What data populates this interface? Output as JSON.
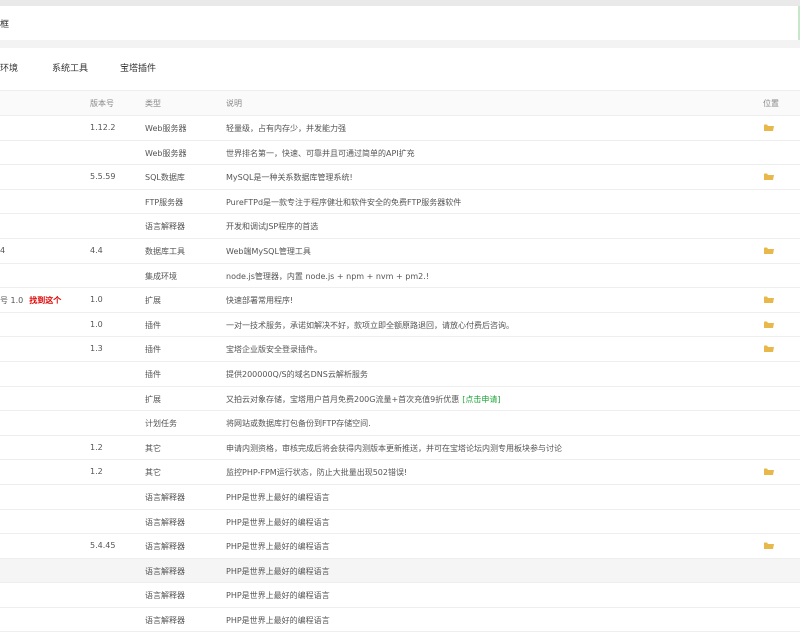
{
  "search": {
    "text": "框"
  },
  "tabs": [
    "环境",
    "系统工具",
    "宝塔插件"
  ],
  "table": {
    "headers": {
      "version": "版本号",
      "type": "类型",
      "desc": "说明",
      "location": "位置"
    },
    "rows": [
      {
        "name": "",
        "version": "1.12.2",
        "type": "Web服务器",
        "desc": "轻量级，占有内存少，并发能力强",
        "folder": true
      },
      {
        "name": "",
        "version": "",
        "type": "Web服务器",
        "desc": "世界排名第一，快速、可靠并且可通过简单的API扩充",
        "folder": false
      },
      {
        "name": "",
        "version": "5.5.59",
        "type": "SQL数据库",
        "desc": "MySQL是一种关系数据库管理系统!",
        "folder": true
      },
      {
        "name": "",
        "version": "",
        "type": "FTP服务器",
        "desc": "PureFTPd是一款专注于程序健壮和软件安全的免费FTP服务器软件",
        "folder": false
      },
      {
        "name": "",
        "version": "",
        "type": "语言解释器",
        "desc": "开发和调试JSP程序的首选",
        "folder": false
      },
      {
        "name": "4",
        "version": "4.4",
        "type": "数据库工具",
        "desc": "Web端MySQL管理工具",
        "folder": true
      },
      {
        "name": "",
        "version": "",
        "type": "集成环境",
        "desc": "node.js管理器，内置 node.js + npm + nvm + pm2.!",
        "folder": false
      },
      {
        "name": "号 1.0",
        "annotation": "找到这个",
        "version": "1.0",
        "type": "扩展",
        "desc": "快速部署常用程序!",
        "folder": true
      },
      {
        "name": "",
        "version": "1.0",
        "type": "插件",
        "desc": "一对一技术服务，承诺如解决不好，款项立即全额原路退回，请放心付费后咨询。",
        "folder": true
      },
      {
        "name": "",
        "version": "1.3",
        "type": "插件",
        "desc": "宝塔企业版安全登录插件。",
        "folder": true
      },
      {
        "name": "",
        "version": "",
        "type": "插件",
        "desc": "提供200000Q/S的域名DNS云解析服务",
        "folder": false
      },
      {
        "name": "",
        "version": "",
        "type": "扩展",
        "desc": "又拍云对象存储，宝塔用户首月免费200G流量+首次充值9折优惠",
        "link": "[点击申请]",
        "folder": false
      },
      {
        "name": "",
        "version": "",
        "type": "计划任务",
        "desc": "将网站或数据库打包备份到FTP存储空间.",
        "folder": false
      },
      {
        "name": "",
        "version": "1.2",
        "type": "其它",
        "desc": "申请内测资格，审核完成后将会获得内测版本更新推送，并可在宝塔论坛内测专用板块参与讨论",
        "folder": false
      },
      {
        "name": "",
        "version": "1.2",
        "type": "其它",
        "desc": "监控PHP-FPM运行状态，防止大批量出现502错误!",
        "folder": true
      },
      {
        "name": "",
        "version": "",
        "type": "语言解释器",
        "desc": "PHP是世界上最好的编程语言",
        "folder": false
      },
      {
        "name": "",
        "version": "",
        "type": "语言解释器",
        "desc": "PHP是世界上最好的编程语言",
        "folder": false
      },
      {
        "name": "",
        "version": "5.4.45",
        "type": "语言解释器",
        "desc": "PHP是世界上最好的编程语言",
        "folder": true
      },
      {
        "name": "",
        "version": "",
        "type": "语言解释器",
        "desc": "PHP是世界上最好的编程语言",
        "folder": false,
        "highlight": true
      },
      {
        "name": "",
        "version": "",
        "type": "语言解释器",
        "desc": "PHP是世界上最好的编程语言",
        "folder": false
      },
      {
        "name": "",
        "version": "",
        "type": "语言解释器",
        "desc": "PHP是世界上最好的编程语言",
        "folder": false
      }
    ]
  },
  "colors": {
    "annotation": "#e00000",
    "link": "#20a53a",
    "folder": "#e8b84a",
    "border": "#eeeeee"
  },
  "icons": {
    "folder": "folder-icon"
  }
}
